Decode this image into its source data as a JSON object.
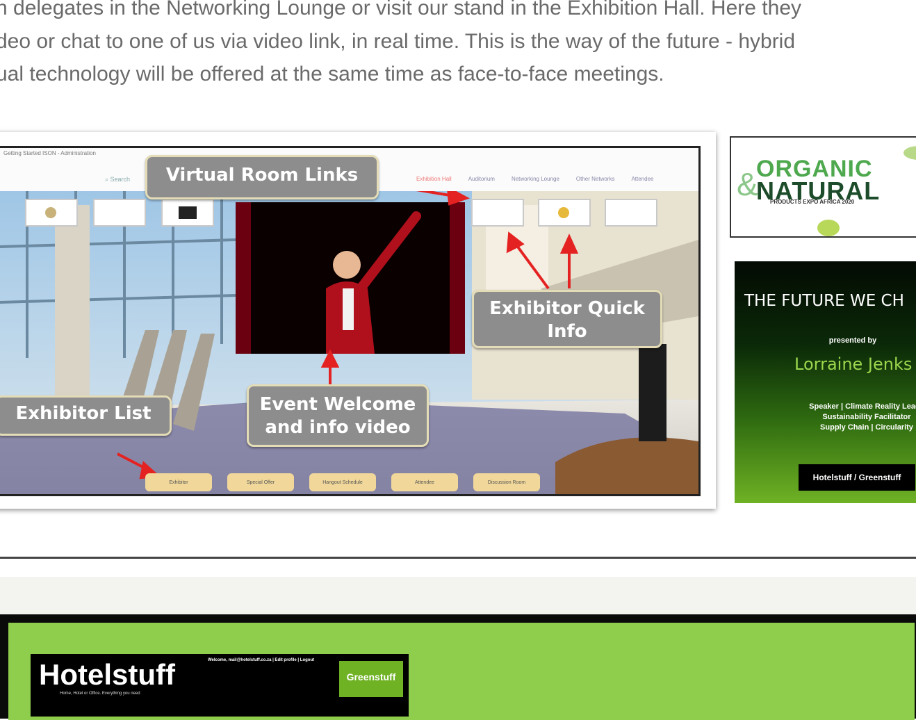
{
  "intro": {
    "lines": [
      "h delegates in the Networking Lounge or visit our stand in the Exhibition Hall. Here they",
      "deo or chat to one of us via video link, in real time. This is the way of the future - hybrid",
      "ual technology will be offered at the same time as face-to-face meetings."
    ]
  },
  "screenshot": {
    "crumbs": "Getting Started   ISON - Administration",
    "search": "Search",
    "nav": [
      "Exhibition Hall",
      "Auditorium",
      "Networking Lounge",
      "Other Networks",
      "Attendee"
    ],
    "callouts": {
      "virtual_room_links": "Virtual Room Links",
      "exhibitor_quick_info_1": "Exhibitor Quick",
      "exhibitor_quick_info_2": "Info",
      "exhibitor_list": "Exhibitor List",
      "event_welcome_1": "Event Welcome",
      "event_welcome_2": "and info video"
    },
    "bottom_bar": [
      "Exhibitor",
      "Special Offer",
      "Hangout Schedule",
      "Attendee",
      "Discussion Room"
    ]
  },
  "organic_banner": {
    "word1": "ORGANIC",
    "word2": "NATURAL",
    "amp": "&",
    "sub": "PRODUCTS EXPO AFRICA 2020"
  },
  "future_banner": {
    "title": "THE FUTURE WE CH",
    "presented_by": "presented by",
    "name": "Lorraine Jenks",
    "roles_1": "Speaker  |  Climate Reality Leade",
    "roles_2": "Sustainability Facilitator",
    "roles_3": "Supply Chain  |  Circularity",
    "brand": "Hotelstuff  /  Greenstuff"
  },
  "lower_banner": {
    "title": "Hotelstuff",
    "tagline": "Home, Hotel or Office. Everything you need",
    "welcome": "Welcome, mail@hotelstuff.co.za  |  Edit profile  |  Logout",
    "green_logo": "Greenstuff"
  },
  "colors": {
    "intro_text": "#6a6a6a",
    "callout_bg": "#8d8d8d",
    "green_band": "#8fce4c",
    "organic_green": "#4ea84e",
    "arrow_red": "#e42222"
  }
}
